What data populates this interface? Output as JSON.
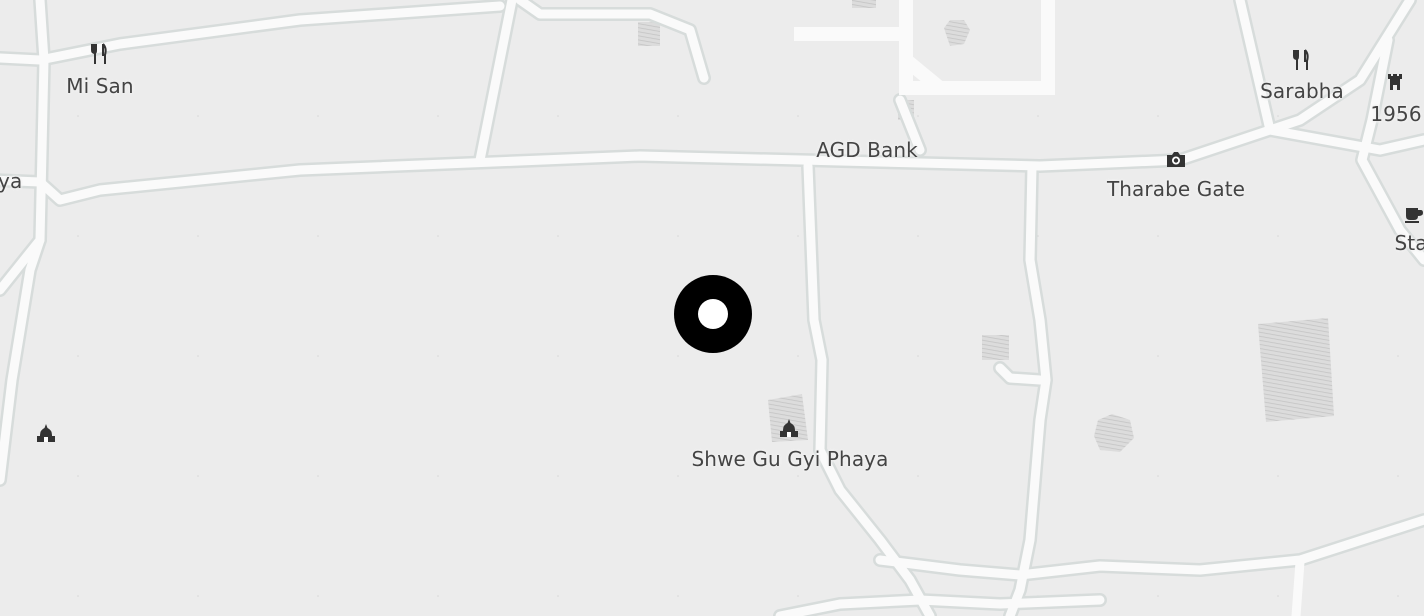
{
  "map": {
    "labels": {
      "mi_san": "Mi San",
      "sarabha": "Sarabha",
      "year_1956": "1956",
      "agd_bank": "AGD Bank",
      "tharabe_gate": "Tharabe Gate",
      "phaya_left": "aya",
      "sta_right": "Sta",
      "shwe_gu_gyi": "Shwe Gu Gyi Phaya"
    },
    "icons": {
      "mi_san": "restaurant-icon",
      "sarabha": "restaurant-icon",
      "year_1956": "monument-icon",
      "tharabe_gate": "camera-icon",
      "sta_right": "cafe-icon",
      "shwe_gu_gyi": "temple-icon",
      "left_temple": "temple-icon"
    },
    "colors": {
      "background": "#ececec",
      "road": "#fafafa",
      "road_edge": "#d9dedd",
      "hatched_area": "#d2d2d2",
      "label": "#444444",
      "marker": "#000000"
    },
    "marker": "location-marker"
  }
}
